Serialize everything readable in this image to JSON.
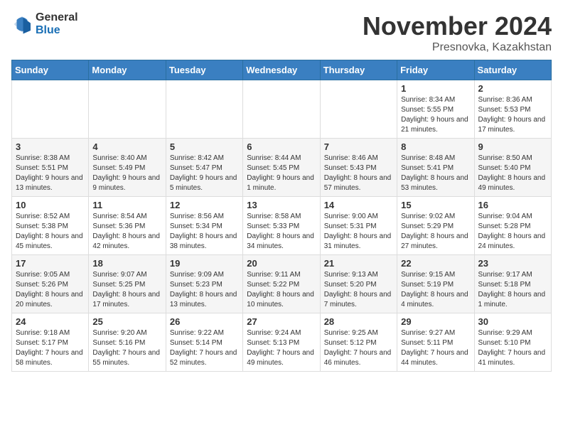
{
  "logo": {
    "general": "General",
    "blue": "Blue"
  },
  "title": "November 2024",
  "location": "Presnovka, Kazakhstan",
  "weekdays": [
    "Sunday",
    "Monday",
    "Tuesday",
    "Wednesday",
    "Thursday",
    "Friday",
    "Saturday"
  ],
  "weeks": [
    [
      {
        "day": "",
        "sunrise": "",
        "sunset": "",
        "daylight": ""
      },
      {
        "day": "",
        "sunrise": "",
        "sunset": "",
        "daylight": ""
      },
      {
        "day": "",
        "sunrise": "",
        "sunset": "",
        "daylight": ""
      },
      {
        "day": "",
        "sunrise": "",
        "sunset": "",
        "daylight": ""
      },
      {
        "day": "",
        "sunrise": "",
        "sunset": "",
        "daylight": ""
      },
      {
        "day": "1",
        "sunrise": "Sunrise: 8:34 AM",
        "sunset": "Sunset: 5:55 PM",
        "daylight": "Daylight: 9 hours and 21 minutes."
      },
      {
        "day": "2",
        "sunrise": "Sunrise: 8:36 AM",
        "sunset": "Sunset: 5:53 PM",
        "daylight": "Daylight: 9 hours and 17 minutes."
      }
    ],
    [
      {
        "day": "3",
        "sunrise": "Sunrise: 8:38 AM",
        "sunset": "Sunset: 5:51 PM",
        "daylight": "Daylight: 9 hours and 13 minutes."
      },
      {
        "day": "4",
        "sunrise": "Sunrise: 8:40 AM",
        "sunset": "Sunset: 5:49 PM",
        "daylight": "Daylight: 9 hours and 9 minutes."
      },
      {
        "day": "5",
        "sunrise": "Sunrise: 8:42 AM",
        "sunset": "Sunset: 5:47 PM",
        "daylight": "Daylight: 9 hours and 5 minutes."
      },
      {
        "day": "6",
        "sunrise": "Sunrise: 8:44 AM",
        "sunset": "Sunset: 5:45 PM",
        "daylight": "Daylight: 9 hours and 1 minute."
      },
      {
        "day": "7",
        "sunrise": "Sunrise: 8:46 AM",
        "sunset": "Sunset: 5:43 PM",
        "daylight": "Daylight: 8 hours and 57 minutes."
      },
      {
        "day": "8",
        "sunrise": "Sunrise: 8:48 AM",
        "sunset": "Sunset: 5:41 PM",
        "daylight": "Daylight: 8 hours and 53 minutes."
      },
      {
        "day": "9",
        "sunrise": "Sunrise: 8:50 AM",
        "sunset": "Sunset: 5:40 PM",
        "daylight": "Daylight: 8 hours and 49 minutes."
      }
    ],
    [
      {
        "day": "10",
        "sunrise": "Sunrise: 8:52 AM",
        "sunset": "Sunset: 5:38 PM",
        "daylight": "Daylight: 8 hours and 45 minutes."
      },
      {
        "day": "11",
        "sunrise": "Sunrise: 8:54 AM",
        "sunset": "Sunset: 5:36 PM",
        "daylight": "Daylight: 8 hours and 42 minutes."
      },
      {
        "day": "12",
        "sunrise": "Sunrise: 8:56 AM",
        "sunset": "Sunset: 5:34 PM",
        "daylight": "Daylight: 8 hours and 38 minutes."
      },
      {
        "day": "13",
        "sunrise": "Sunrise: 8:58 AM",
        "sunset": "Sunset: 5:33 PM",
        "daylight": "Daylight: 8 hours and 34 minutes."
      },
      {
        "day": "14",
        "sunrise": "Sunrise: 9:00 AM",
        "sunset": "Sunset: 5:31 PM",
        "daylight": "Daylight: 8 hours and 31 minutes."
      },
      {
        "day": "15",
        "sunrise": "Sunrise: 9:02 AM",
        "sunset": "Sunset: 5:29 PM",
        "daylight": "Daylight: 8 hours and 27 minutes."
      },
      {
        "day": "16",
        "sunrise": "Sunrise: 9:04 AM",
        "sunset": "Sunset: 5:28 PM",
        "daylight": "Daylight: 8 hours and 24 minutes."
      }
    ],
    [
      {
        "day": "17",
        "sunrise": "Sunrise: 9:05 AM",
        "sunset": "Sunset: 5:26 PM",
        "daylight": "Daylight: 8 hours and 20 minutes."
      },
      {
        "day": "18",
        "sunrise": "Sunrise: 9:07 AM",
        "sunset": "Sunset: 5:25 PM",
        "daylight": "Daylight: 8 hours and 17 minutes."
      },
      {
        "day": "19",
        "sunrise": "Sunrise: 9:09 AM",
        "sunset": "Sunset: 5:23 PM",
        "daylight": "Daylight: 8 hours and 13 minutes."
      },
      {
        "day": "20",
        "sunrise": "Sunrise: 9:11 AM",
        "sunset": "Sunset: 5:22 PM",
        "daylight": "Daylight: 8 hours and 10 minutes."
      },
      {
        "day": "21",
        "sunrise": "Sunrise: 9:13 AM",
        "sunset": "Sunset: 5:20 PM",
        "daylight": "Daylight: 8 hours and 7 minutes."
      },
      {
        "day": "22",
        "sunrise": "Sunrise: 9:15 AM",
        "sunset": "Sunset: 5:19 PM",
        "daylight": "Daylight: 8 hours and 4 minutes."
      },
      {
        "day": "23",
        "sunrise": "Sunrise: 9:17 AM",
        "sunset": "Sunset: 5:18 PM",
        "daylight": "Daylight: 8 hours and 1 minute."
      }
    ],
    [
      {
        "day": "24",
        "sunrise": "Sunrise: 9:18 AM",
        "sunset": "Sunset: 5:17 PM",
        "daylight": "Daylight: 7 hours and 58 minutes."
      },
      {
        "day": "25",
        "sunrise": "Sunrise: 9:20 AM",
        "sunset": "Sunset: 5:16 PM",
        "daylight": "Daylight: 7 hours and 55 minutes."
      },
      {
        "day": "26",
        "sunrise": "Sunrise: 9:22 AM",
        "sunset": "Sunset: 5:14 PM",
        "daylight": "Daylight: 7 hours and 52 minutes."
      },
      {
        "day": "27",
        "sunrise": "Sunrise: 9:24 AM",
        "sunset": "Sunset: 5:13 PM",
        "daylight": "Daylight: 7 hours and 49 minutes."
      },
      {
        "day": "28",
        "sunrise": "Sunrise: 9:25 AM",
        "sunset": "Sunset: 5:12 PM",
        "daylight": "Daylight: 7 hours and 46 minutes."
      },
      {
        "day": "29",
        "sunrise": "Sunrise: 9:27 AM",
        "sunset": "Sunset: 5:11 PM",
        "daylight": "Daylight: 7 hours and 44 minutes."
      },
      {
        "day": "30",
        "sunrise": "Sunrise: 9:29 AM",
        "sunset": "Sunset: 5:10 PM",
        "daylight": "Daylight: 7 hours and 41 minutes."
      }
    ]
  ]
}
